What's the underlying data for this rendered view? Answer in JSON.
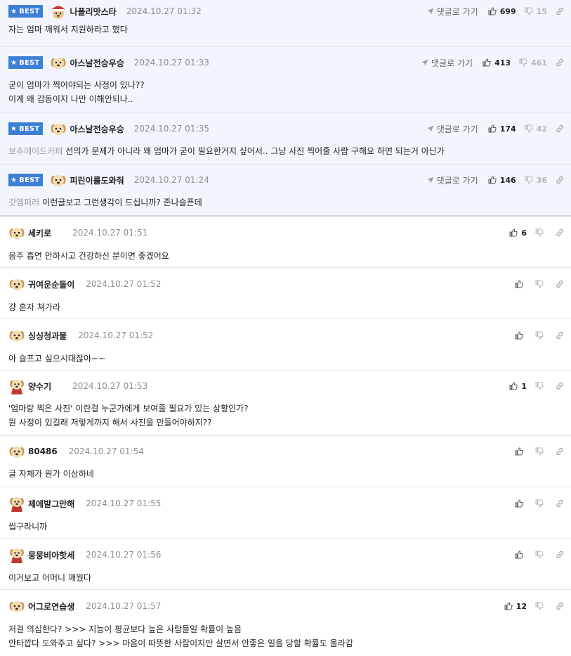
{
  "labels": {
    "best": "BEST",
    "reply": "댓글로 가기"
  },
  "colors": {
    "best_badge": "#3d7fd6",
    "best_bg": "#f2f5fb",
    "date": "#8a8f96",
    "muted": "#b4b8bd"
  },
  "best_comments": [
    {
      "nick": "나폴리맛스타",
      "date": "2024.10.27 01:32",
      "up": "699",
      "down": "15",
      "avatar": "mascot-hat",
      "origin": "",
      "lines": [
        "자는 엄마 깨워서 지원하라고 했다"
      ]
    },
    {
      "nick": "아스날전승우승",
      "date": "2024.10.27 01:33",
      "up": "413",
      "down": "461",
      "avatar": "puppy",
      "origin": "",
      "lines": [
        "굳이 엄마가 찍어야되는 사정이 있나??",
        "이게 왜 감동이지 나만 이해안되나.."
      ]
    },
    {
      "nick": "아스날전승우승",
      "date": "2024.10.27 01:35",
      "up": "174",
      "down": "42",
      "avatar": "puppy",
      "origin": "보추메이드카페",
      "lines": [
        "선의가 문제가 아니라 왜 엄마가 굳이 필요한거지 싶어서.. 그냥 사진 찍어줄 사람 구해요 하면 되는거 아닌가"
      ]
    },
    {
      "nick": "피린이를도와줘",
      "date": "2024.10.27 01:24",
      "up": "146",
      "down": "36",
      "avatar": "puppy",
      "origin": "갓엠퍼러",
      "lines": [
        "이런글보고 그런생각이 드십니까? 존나슬픈데"
      ]
    }
  ],
  "comments": [
    {
      "nick": "세키로",
      "date": "2024.10.27 01:51",
      "up": "6",
      "avatar": "puppy",
      "lines": [
        "음주 흡연 안하시고 건강하신 분이면 좋겠어요"
      ]
    },
    {
      "nick": "귀여운순돌이",
      "date": "2024.10.27 01:52",
      "up": "",
      "avatar": "puppy",
      "lines": [
        "걍 혼자 쳐가라"
      ]
    },
    {
      "nick": "싱싱청과물",
      "date": "2024.10.27 01:52",
      "up": "",
      "avatar": "puppy",
      "lines": [
        "아 슬프고 싶으시대잖아~~"
      ]
    },
    {
      "nick": "양수기",
      "date": "2024.10.27 01:53",
      "up": "1",
      "avatar": "puppy-cape",
      "lines": [
        "'엄마랑 찍은 사진' 이란걸 누군가에게 보여줄 필요가 있는 상황인가?",
        "뭔 사정이 있길래 저렇게까지 해서 사진을 만들어야하지??"
      ]
    },
    {
      "nick": "80486",
      "date": "2024.10.27 01:54",
      "up": "",
      "avatar": "puppy",
      "lines": [
        "글 자체가 뭔가 이상하네"
      ]
    },
    {
      "nick": "제에발그만해",
      "date": "2024.10.27 01:55",
      "up": "",
      "avatar": "puppy-cape",
      "lines": [
        "씹구라니까"
      ]
    },
    {
      "nick": "뭉뭉비아핫세",
      "date": "2024.10.27 01:56",
      "up": "",
      "avatar": "puppy-cape",
      "lines": [
        "이거보고 어머니 깨웠다"
      ]
    },
    {
      "nick": "어그로연습생",
      "date": "2024.10.27 01:57",
      "up": "12",
      "avatar": "puppy",
      "lines": [
        "저걸 의심한다? >>> 지능이 평균보다 높은 사람들일 확률이 높음",
        "안타깝다 도와주고 싶다? >>> 마음이 따뜻한 사람이지만 살면서 안좋은 일을 당할 확률도 올라감"
      ]
    }
  ]
}
